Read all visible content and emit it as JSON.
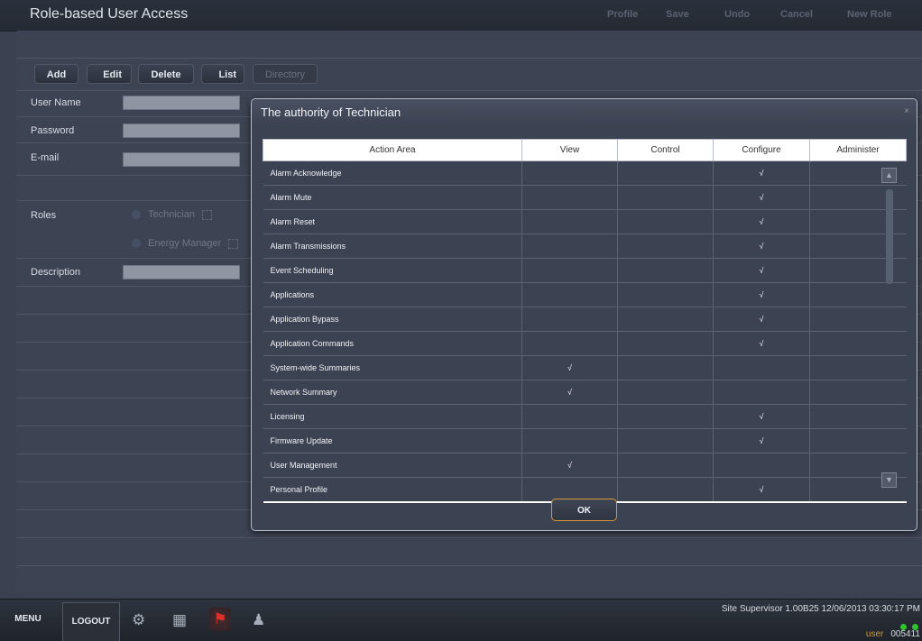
{
  "header": {
    "title": "Role-based User Access",
    "buttons": {
      "profile": "Profile",
      "save": "Save",
      "undo": "Undo",
      "cancel": "Cancel",
      "new_role": "New Role"
    }
  },
  "toolbar": {
    "add": "Add",
    "edit": "Edit",
    "delete": "Delete",
    "list": "List",
    "directory": "Directory"
  },
  "form": {
    "user_name_label": "User Name",
    "password_label": "Password",
    "email_label": "E-mail",
    "roles_label": "Roles",
    "description_label": "Description",
    "roles": {
      "technician": "Technician",
      "energy_manager": "Energy Manager"
    }
  },
  "dialog": {
    "title": "The authority of Technician",
    "close": "×",
    "ok": "OK",
    "columns": {
      "area": "Action Area",
      "view": "View",
      "control": "Control",
      "configure": "Configure",
      "administer": "Administer"
    },
    "rows": [
      {
        "area": "Alarm Acknowledge",
        "view": "",
        "control": "",
        "configure": "√",
        "administer": ""
      },
      {
        "area": "Alarm Mute",
        "view": "",
        "control": "",
        "configure": "√",
        "administer": ""
      },
      {
        "area": "Alarm Reset",
        "view": "",
        "control": "",
        "configure": "√",
        "administer": ""
      },
      {
        "area": "Alarm Transmissions",
        "view": "",
        "control": "",
        "configure": "√",
        "administer": ""
      },
      {
        "area": "Event Scheduling",
        "view": "",
        "control": "",
        "configure": "√",
        "administer": ""
      },
      {
        "area": "Applications",
        "view": "",
        "control": "",
        "configure": "√",
        "administer": ""
      },
      {
        "area": "Application Bypass",
        "view": "",
        "control": "",
        "configure": "√",
        "administer": ""
      },
      {
        "area": "Application Commands",
        "view": "",
        "control": "",
        "configure": "√",
        "administer": ""
      },
      {
        "area": "System-wide Summaries",
        "view": "√",
        "control": "",
        "configure": "",
        "administer": ""
      },
      {
        "area": "Network Summary",
        "view": "√",
        "control": "",
        "configure": "",
        "administer": ""
      },
      {
        "area": "Licensing",
        "view": "",
        "control": "",
        "configure": "√",
        "administer": ""
      },
      {
        "area": "Firmware Update",
        "view": "",
        "control": "",
        "configure": "√",
        "administer": ""
      },
      {
        "area": "User Management",
        "view": "√",
        "control": "",
        "configure": "",
        "administer": ""
      },
      {
        "area": "Personal Profile",
        "view": "",
        "control": "",
        "configure": "√",
        "administer": ""
      }
    ]
  },
  "footer": {
    "menu": "MENU",
    "logout": "LOGOUT",
    "status": "Site Supervisor 1.00B25 12/06/2013 03:30:17 PM",
    "user": "user",
    "user_id": "005411",
    "icons": [
      "gear-icon",
      "calendar-icon",
      "alarm-bell-icon",
      "users-icon"
    ],
    "colors": {
      "alarm": "#d9302c",
      "led": "#2fc22f",
      "ok_border": "#d89a38"
    }
  }
}
